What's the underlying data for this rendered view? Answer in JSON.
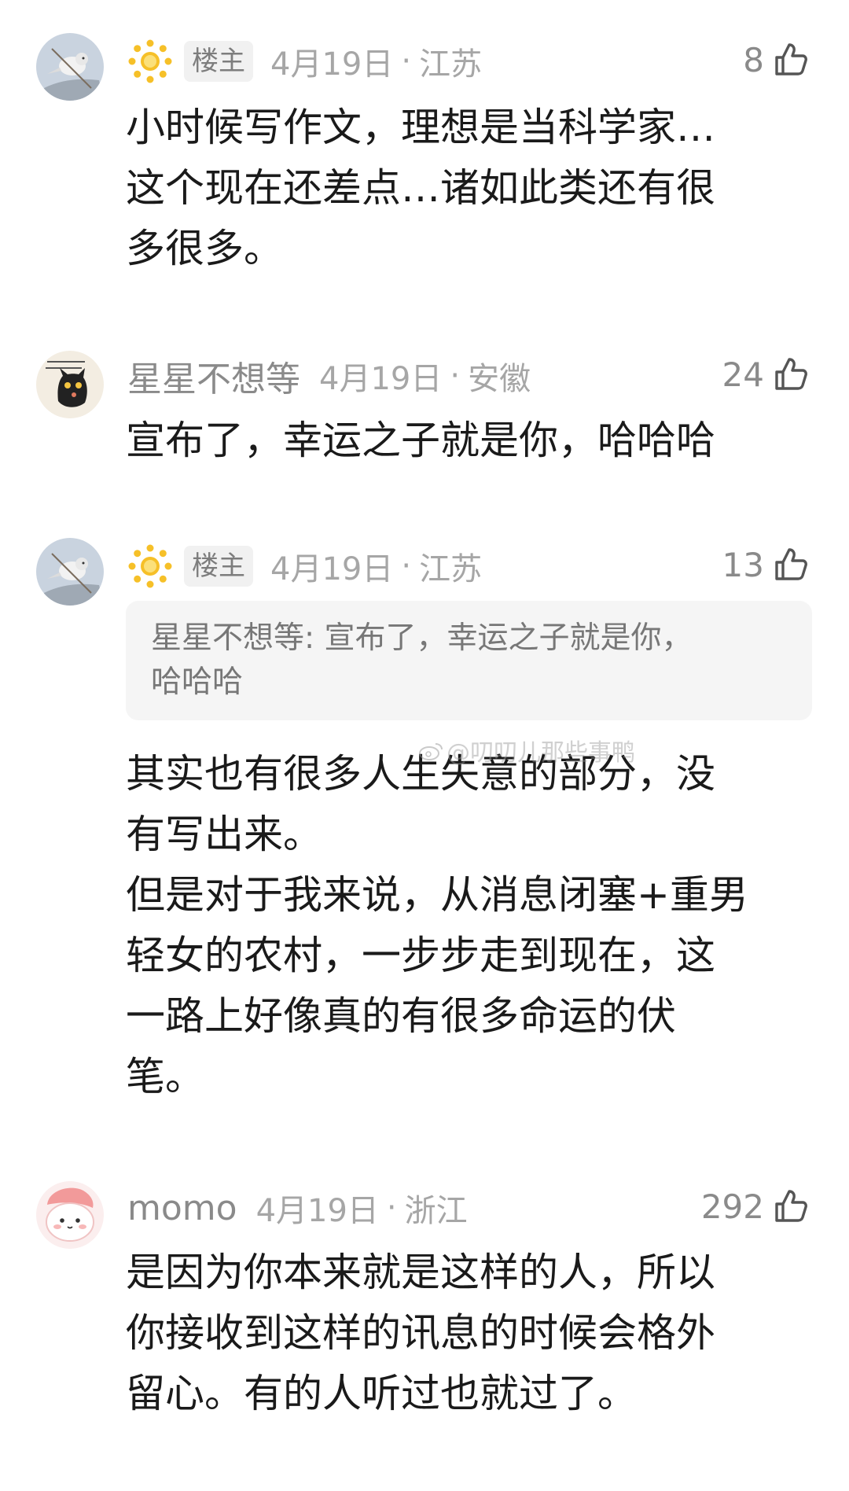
{
  "comments": [
    {
      "username": "",
      "op_badge": "楼主",
      "date": "4月19日",
      "separator": "·",
      "region": "江苏",
      "likes": "8",
      "text": "小时候写作文，理想是当科学家…\n这个现在还差点…诸如此类还有很\n多很多。"
    },
    {
      "username": "星星不想等",
      "date": "4月19日",
      "separator": "·",
      "region": "安徽",
      "likes": "24",
      "text": "宣布了，幸运之子就是你，哈哈哈"
    },
    {
      "username": "",
      "op_badge": "楼主",
      "date": "4月19日",
      "separator": "·",
      "region": "江苏",
      "likes": "13",
      "quote": "星星不想等: 宣布了，幸运之子就是你，\n哈哈哈",
      "text": "其实也有很多人生失意的部分，没\n有写出来。\n但是对于我来说，从消息闭塞+重男\n轻女的农村，一步步走到现在，这\n一路上好像真的有很多命运的伏\n笔。"
    },
    {
      "username": "momo",
      "date": "4月19日",
      "separator": "·",
      "region": "浙江",
      "likes": "292",
      "text": "是因为你本来就是这样的人，所以\n你接收到这样的讯息的时候会格外\n留心。有的人听过也就过了。"
    }
  ],
  "watermark": "@叨叨儿那些事鸭",
  "icons": {
    "like": "thumbs-up-icon",
    "level": "sun-icon",
    "watermark": "weibo-logo-icon"
  },
  "colors": {
    "text": "#1a1a1a",
    "meta": "#a6a6a6",
    "quote_bg": "#f5f5f5",
    "sun": "#f6c028"
  }
}
